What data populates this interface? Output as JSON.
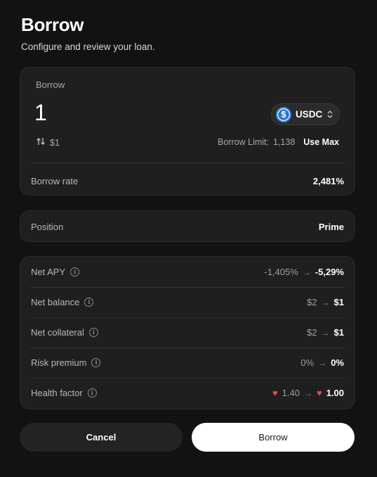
{
  "header": {
    "title": "Borrow",
    "subtitle": "Configure and review your loan."
  },
  "borrow_card": {
    "label": "Borrow",
    "amount": "1",
    "token": {
      "name": "USDC",
      "icon": "usdc-token-icon",
      "icon_glyph": "$",
      "color": "#2775ca"
    },
    "usd_value": "$1",
    "borrow_limit_label": "Borrow Limit:",
    "borrow_limit_value": "1,138",
    "use_max_label": "Use Max",
    "borrow_rate_label": "Borrow rate",
    "borrow_rate_value": "2,481%"
  },
  "position": {
    "label": "Position",
    "value": "Prime"
  },
  "stats": [
    {
      "label": "Net APY",
      "from": "-1,405%",
      "to": "-5,29%"
    },
    {
      "label": "Net balance",
      "from": "$2",
      "to": "$1"
    },
    {
      "label": "Net collateral",
      "from": "$2",
      "to": "$1"
    },
    {
      "label": "Risk premium",
      "from": "0%",
      "to": "0%"
    },
    {
      "label": "Health factor",
      "from": "1.40",
      "to": "1.00"
    }
  ],
  "colors": {
    "background": "#121212",
    "card": "#1f1f1f",
    "heart": "#ff4545"
  },
  "actions": {
    "cancel_label": "Cancel",
    "borrow_label": "Borrow"
  }
}
